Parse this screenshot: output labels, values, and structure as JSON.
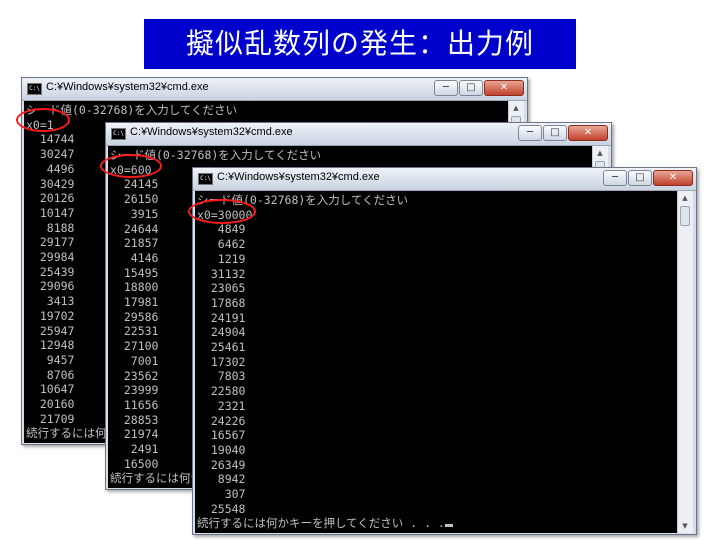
{
  "slide": {
    "title": "擬似乱数列の発生：出力例"
  },
  "windows": [
    {
      "title": "C:¥Windows¥system32¥cmd.exe",
      "prompt": "シード値(0-32768)を入力してください",
      "seed_line": "x0=1",
      "values": [
        "14744",
        "30247",
        "4496",
        "30429",
        "20126",
        "10147",
        "8188",
        "29177",
        "29984",
        "25439",
        "29096",
        "3413",
        "19702",
        "25947",
        "12948",
        "9457",
        "8706",
        "10647",
        "20160",
        "21709"
      ],
      "footer": "続行するには何かキーを押してください . . ."
    },
    {
      "title": "C:¥Windows¥system32¥cmd.exe",
      "prompt": "シード値(0-32768)を入力してください",
      "seed_line": "x0=600",
      "values": [
        "24145",
        "26150",
        "3915",
        "24644",
        "21857",
        "4146",
        "15495",
        "18800",
        "17981",
        "29586",
        "22531",
        "27100",
        "7001",
        "23562",
        "23999",
        "11656",
        "28853",
        "21974",
        "2491",
        "16500"
      ],
      "footer": "続行するには何かキーを押してください . . ."
    },
    {
      "title": "C:¥Windows¥system32¥cmd.exe",
      "prompt": "シード値(0-32768)を入力してください",
      "seed_line": "x0=30000",
      "values": [
        "4849",
        "6462",
        "1219",
        "31132",
        "23065",
        "17868",
        "24191",
        "24904",
        "25461",
        "17302",
        "7803",
        "22580",
        "2321",
        "24226",
        "16567",
        "19040",
        "26349",
        "8942",
        "307",
        "25548"
      ],
      "footer": "続行するには何かキーを押してください . . ."
    }
  ],
  "window_buttons": {
    "minimize": "─",
    "maximize": "□",
    "close": "✕"
  },
  "icons": {
    "cmd": "C:\\",
    "scroll_up": "▲",
    "scroll_down": "▼"
  },
  "colors": {
    "title_bg": "#0000cc",
    "highlight": "#ff1a1a",
    "console_bg": "#000000",
    "console_fg": "#c0c0c0"
  }
}
